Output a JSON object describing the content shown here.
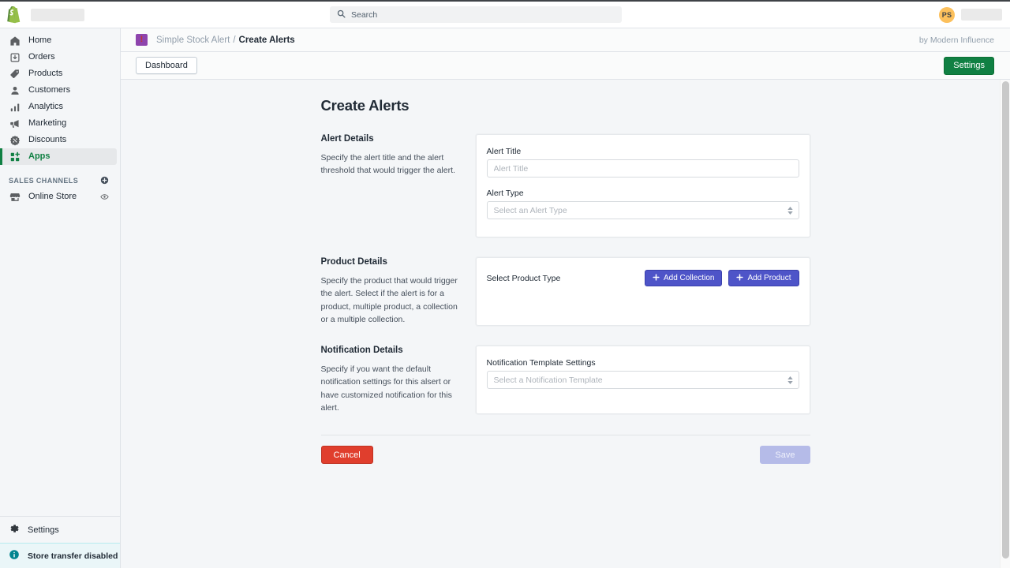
{
  "topbar": {
    "logo_icon": "shopify-logo",
    "search": {
      "icon": "search-icon",
      "placeholder": "Search",
      "value": ""
    },
    "user": {
      "initials": "PS",
      "avatar_color": "#fcc05c"
    }
  },
  "sidebar": {
    "items": [
      {
        "label": "Home",
        "icon": "home-icon",
        "active": false
      },
      {
        "label": "Orders",
        "icon": "orders-icon",
        "active": false
      },
      {
        "label": "Products",
        "icon": "products-tag-icon",
        "active": false
      },
      {
        "label": "Customers",
        "icon": "customers-person-icon",
        "active": false
      },
      {
        "label": "Analytics",
        "icon": "analytics-bars-icon",
        "active": false
      },
      {
        "label": "Marketing",
        "icon": "marketing-megaphone-icon",
        "active": false
      },
      {
        "label": "Discounts",
        "icon": "discounts-icon",
        "active": false
      },
      {
        "label": "Apps",
        "icon": "apps-grid-icon",
        "active": true
      }
    ],
    "sales_channels": {
      "heading": "SALES CHANNELS",
      "add_icon": "plus-circle-icon",
      "items": [
        {
          "label": "Online Store",
          "icon": "store-icon",
          "trailing_icon": "eye-icon"
        }
      ]
    },
    "settings": {
      "label": "Settings",
      "icon": "gear-icon"
    },
    "banner": {
      "label": "Store transfer disabled",
      "icon": "info-circle-icon",
      "accent": "#00848e"
    }
  },
  "app_bar": {
    "app_icon": "alert-exclamation-icon",
    "app_icon_bg": "#8e44ad",
    "breadcrumb_app": "Simple Stock Alert",
    "breadcrumb_separator": "/",
    "breadcrumb_current": "Create Alerts",
    "developer_credit": "by Modern Influence"
  },
  "action_bar": {
    "dashboard_label": "Dashboard",
    "settings_label": "Settings",
    "settings_color": "#108043"
  },
  "page": {
    "title": "Create Alerts",
    "sections": [
      {
        "title": "Alert Details",
        "description": "Specify the alert title and the alert threshold that would trigger the alert.",
        "fields": [
          {
            "label": "Alert Title",
            "placeholder": "Alert Title",
            "value": "",
            "type": "text"
          },
          {
            "label": "Alert Type",
            "placeholder": "Select an Alert Type",
            "value": "",
            "type": "select"
          }
        ]
      },
      {
        "title": "Product Details",
        "description": "Specify the product that would trigger the alert. Select if the alert is for a product, multiple product, a collection or a multiple collection.",
        "row_label": "Select Product Type",
        "buttons": [
          {
            "label": "Add Collection",
            "icon": "plus-icon",
            "color": "#4e54c8"
          },
          {
            "label": "Add Product",
            "icon": "plus-icon",
            "color": "#4e54c8"
          }
        ]
      },
      {
        "title": "Notification Details",
        "description": "Specify if you want the default notification settings for this alsert or have customized notification for this alert.",
        "fields": [
          {
            "label": "Notification Template Settings",
            "placeholder": "Select a Notification Template",
            "value": "",
            "type": "select"
          }
        ]
      }
    ],
    "footer": {
      "cancel_label": "Cancel",
      "cancel_color": "#e03e2d",
      "save_label": "Save",
      "save_color": "#b5bbe8",
      "save_disabled": true
    }
  }
}
